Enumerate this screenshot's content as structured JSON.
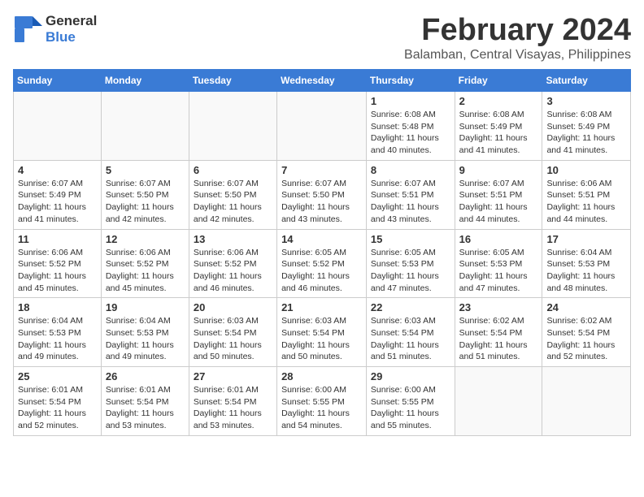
{
  "header": {
    "logo_general": "General",
    "logo_blue": "Blue",
    "month_title": "February 2024",
    "location": "Balamban, Central Visayas, Philippines"
  },
  "days_of_week": [
    "Sunday",
    "Monday",
    "Tuesday",
    "Wednesday",
    "Thursday",
    "Friday",
    "Saturday"
  ],
  "weeks": [
    [
      {
        "day": "",
        "info": ""
      },
      {
        "day": "",
        "info": ""
      },
      {
        "day": "",
        "info": ""
      },
      {
        "day": "",
        "info": ""
      },
      {
        "day": "1",
        "info": "Sunrise: 6:08 AM\nSunset: 5:48 PM\nDaylight: 11 hours and 40 minutes."
      },
      {
        "day": "2",
        "info": "Sunrise: 6:08 AM\nSunset: 5:49 PM\nDaylight: 11 hours and 41 minutes."
      },
      {
        "day": "3",
        "info": "Sunrise: 6:08 AM\nSunset: 5:49 PM\nDaylight: 11 hours and 41 minutes."
      }
    ],
    [
      {
        "day": "4",
        "info": "Sunrise: 6:07 AM\nSunset: 5:49 PM\nDaylight: 11 hours and 41 minutes."
      },
      {
        "day": "5",
        "info": "Sunrise: 6:07 AM\nSunset: 5:50 PM\nDaylight: 11 hours and 42 minutes."
      },
      {
        "day": "6",
        "info": "Sunrise: 6:07 AM\nSunset: 5:50 PM\nDaylight: 11 hours and 42 minutes."
      },
      {
        "day": "7",
        "info": "Sunrise: 6:07 AM\nSunset: 5:50 PM\nDaylight: 11 hours and 43 minutes."
      },
      {
        "day": "8",
        "info": "Sunrise: 6:07 AM\nSunset: 5:51 PM\nDaylight: 11 hours and 43 minutes."
      },
      {
        "day": "9",
        "info": "Sunrise: 6:07 AM\nSunset: 5:51 PM\nDaylight: 11 hours and 44 minutes."
      },
      {
        "day": "10",
        "info": "Sunrise: 6:06 AM\nSunset: 5:51 PM\nDaylight: 11 hours and 44 minutes."
      }
    ],
    [
      {
        "day": "11",
        "info": "Sunrise: 6:06 AM\nSunset: 5:52 PM\nDaylight: 11 hours and 45 minutes."
      },
      {
        "day": "12",
        "info": "Sunrise: 6:06 AM\nSunset: 5:52 PM\nDaylight: 11 hours and 45 minutes."
      },
      {
        "day": "13",
        "info": "Sunrise: 6:06 AM\nSunset: 5:52 PM\nDaylight: 11 hours and 46 minutes."
      },
      {
        "day": "14",
        "info": "Sunrise: 6:05 AM\nSunset: 5:52 PM\nDaylight: 11 hours and 46 minutes."
      },
      {
        "day": "15",
        "info": "Sunrise: 6:05 AM\nSunset: 5:53 PM\nDaylight: 11 hours and 47 minutes."
      },
      {
        "day": "16",
        "info": "Sunrise: 6:05 AM\nSunset: 5:53 PM\nDaylight: 11 hours and 47 minutes."
      },
      {
        "day": "17",
        "info": "Sunrise: 6:04 AM\nSunset: 5:53 PM\nDaylight: 11 hours and 48 minutes."
      }
    ],
    [
      {
        "day": "18",
        "info": "Sunrise: 6:04 AM\nSunset: 5:53 PM\nDaylight: 11 hours and 49 minutes."
      },
      {
        "day": "19",
        "info": "Sunrise: 6:04 AM\nSunset: 5:53 PM\nDaylight: 11 hours and 49 minutes."
      },
      {
        "day": "20",
        "info": "Sunrise: 6:03 AM\nSunset: 5:54 PM\nDaylight: 11 hours and 50 minutes."
      },
      {
        "day": "21",
        "info": "Sunrise: 6:03 AM\nSunset: 5:54 PM\nDaylight: 11 hours and 50 minutes."
      },
      {
        "day": "22",
        "info": "Sunrise: 6:03 AM\nSunset: 5:54 PM\nDaylight: 11 hours and 51 minutes."
      },
      {
        "day": "23",
        "info": "Sunrise: 6:02 AM\nSunset: 5:54 PM\nDaylight: 11 hours and 51 minutes."
      },
      {
        "day": "24",
        "info": "Sunrise: 6:02 AM\nSunset: 5:54 PM\nDaylight: 11 hours and 52 minutes."
      }
    ],
    [
      {
        "day": "25",
        "info": "Sunrise: 6:01 AM\nSunset: 5:54 PM\nDaylight: 11 hours and 52 minutes."
      },
      {
        "day": "26",
        "info": "Sunrise: 6:01 AM\nSunset: 5:54 PM\nDaylight: 11 hours and 53 minutes."
      },
      {
        "day": "27",
        "info": "Sunrise: 6:01 AM\nSunset: 5:54 PM\nDaylight: 11 hours and 53 minutes."
      },
      {
        "day": "28",
        "info": "Sunrise: 6:00 AM\nSunset: 5:55 PM\nDaylight: 11 hours and 54 minutes."
      },
      {
        "day": "29",
        "info": "Sunrise: 6:00 AM\nSunset: 5:55 PM\nDaylight: 11 hours and 55 minutes."
      },
      {
        "day": "",
        "info": ""
      },
      {
        "day": "",
        "info": ""
      }
    ]
  ]
}
